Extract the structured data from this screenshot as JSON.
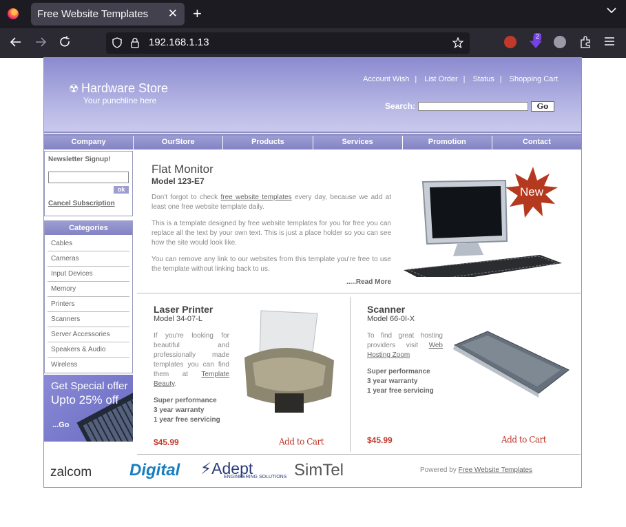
{
  "browser": {
    "tab_title": "Free Website Templates",
    "close": "✕",
    "new_tab": "+",
    "url": "192.168.1.13",
    "ext_badge": "2"
  },
  "header": {
    "logo_name": "Hardware Store",
    "logo_tagline": "Your punchline here",
    "links": [
      "Account Wish",
      "List Order",
      "Status",
      "Shopping Cart"
    ],
    "search_label": "Search:",
    "go_label": "Go"
  },
  "menu": [
    "Company",
    "OurStore",
    "Products",
    "Services",
    "Promotion",
    "Contact"
  ],
  "newsletter": {
    "title": "Newsletter Signup!",
    "ok_label": "ok",
    "cancel_label": "Cancel Subscription"
  },
  "categories": {
    "title": "Categories",
    "items": [
      "Cables",
      "Cameras",
      "Input Devices",
      "Memory",
      "Printers",
      "Scanners",
      "Server Accessories",
      "Speakers & Audio",
      "Wireless"
    ]
  },
  "promo": {
    "line1": "Get Special offer",
    "line2": "Upto 25% off",
    "go": "...Go"
  },
  "feature": {
    "title": "Flat Monitor",
    "model": "Model 123-E7",
    "p1_pre": "Don't forgot to check ",
    "p1_link": "free website templates",
    "p1_post": " every day, because we add at least one free website template daily.",
    "p2": "This is a template designed by free website templates for you for free you can replace all the text by your own text. This is just a place holder so you can see how the site would look like.",
    "p3": "You can remove any link to our websites from this template you're free to use the template without linking back to us.",
    "read_more": ".....Read More",
    "badge": "New"
  },
  "products": [
    {
      "title": "Laser Printer",
      "model": "Model 34-07-L",
      "text_pre": "If you're looking for beautiful and professionally made templates you can find them at ",
      "link": "Template Beauty",
      "text_post": ".",
      "features": [
        "Super performance",
        "3 year warranty",
        "1 year free servicing"
      ],
      "price": "$45.99",
      "cart": "Add to Cart"
    },
    {
      "title": "Scanner",
      "model": "Model 66-0I-X",
      "text_pre": "To find great hosting providers visit ",
      "link": "Web Hosting Zoom",
      "text_post": "",
      "features": [
        "Super performance",
        "3 year warranty",
        "1 year free servicing"
      ],
      "price": "$45.99",
      "cart": "Add to Cart"
    }
  ],
  "footer": {
    "logos": [
      "zalcom",
      "Digital",
      "Adept",
      "SimTel"
    ],
    "adept_sub": "ENGINEERING SOLUTIONS",
    "powered_pre": "Powered by ",
    "powered_link": "Free Website Templates"
  }
}
